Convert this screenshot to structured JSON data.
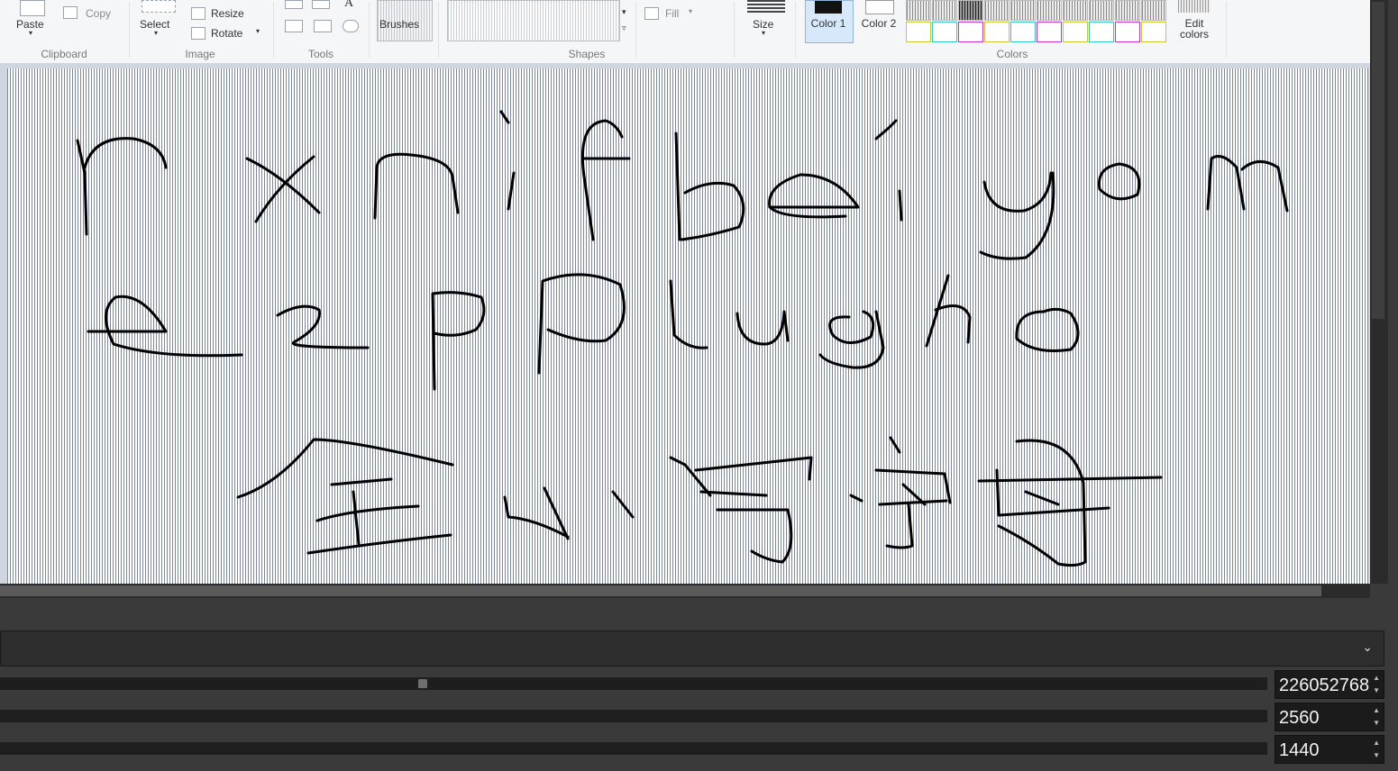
{
  "ribbon": {
    "clipboard": {
      "paste_label": "Paste",
      "copy_label": "Copy",
      "group_label": "Clipboard"
    },
    "image": {
      "select_label": "Select",
      "resize_label": "Resize",
      "rotate_label": "Rotate",
      "group_label": "Image"
    },
    "tools": {
      "group_label": "Tools",
      "text_tool_glyph": "A"
    },
    "brushes_label": "Brushes",
    "shapes": {
      "group_label": "Shapes",
      "fill_label": "Fill"
    },
    "size_label": "Size",
    "color1_label": "Color 1",
    "color2_label": "Color 2",
    "colors_group_label": "Colors",
    "edit_colors_label": "Edit colors"
  },
  "canvas": {
    "handwriting_lines": [
      "rxnifbeiyom",
      "e2pPlugho",
      "全小写字母"
    ]
  },
  "controls": {
    "dropdown_icon": "chevron-down-icon",
    "slider_value": 226052768,
    "slider_fraction": 0.33,
    "width_value": 2560,
    "height_value": 1440
  },
  "colors": {
    "canvas_bg": "#ffffff",
    "ink": "#000000",
    "panel_bg": "#3a3a3a"
  }
}
